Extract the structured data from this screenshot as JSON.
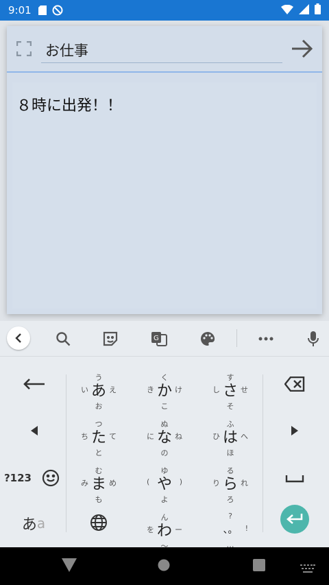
{
  "status": {
    "time": "9:01"
  },
  "dialog": {
    "title_value": "お仕事",
    "body_text": "８時に出発！！"
  },
  "keyboard": {
    "toolbar_icons": [
      "back-chevron-icon",
      "search-icon",
      "sticker-icon",
      "translate-icon",
      "palette-icon",
      "more-icon",
      "mic-icon"
    ],
    "rows": [
      [
        {
          "main": "あ",
          "t": "う",
          "l": "い",
          "r": "え",
          "b": "お"
        },
        {
          "main": "か",
          "t": "く",
          "l": "き",
          "r": "け",
          "b": "こ"
        },
        {
          "main": "さ",
          "t": "す",
          "l": "し",
          "r": "せ",
          "b": "そ"
        }
      ],
      [
        {
          "main": "た",
          "t": "つ",
          "l": "ち",
          "r": "て",
          "b": "と"
        },
        {
          "main": "な",
          "t": "ぬ",
          "l": "に",
          "r": "ね",
          "b": "の"
        },
        {
          "main": "は",
          "t": "ふ",
          "l": "ひ",
          "r": "へ",
          "b": "ほ"
        }
      ],
      [
        {
          "main": "ま",
          "t": "む",
          "l": "み",
          "r": "め",
          "b": "も"
        },
        {
          "main": "や",
          "t": "ゆ",
          "l": "(",
          "r": ")",
          "b": "よ"
        },
        {
          "main": "ら",
          "t": "る",
          "l": "り",
          "r": "れ",
          "b": "ろ"
        }
      ],
      [
        {
          "main": "わ",
          "t": "ん",
          "l": "を",
          "r": "ー",
          "b": "〜"
        },
        {
          "main": "、。",
          "t": "?",
          "l": "",
          "r": "!",
          "b": "…"
        }
      ]
    ],
    "num_label": "?123",
    "kana_toggle": "あa",
    "kana_toggle_main": "あ",
    "kana_toggle_sub": "a"
  },
  "colors": {
    "statusbar": "#1976d2",
    "enter": "#4db6ac",
    "dialog": "#d3ddea"
  }
}
